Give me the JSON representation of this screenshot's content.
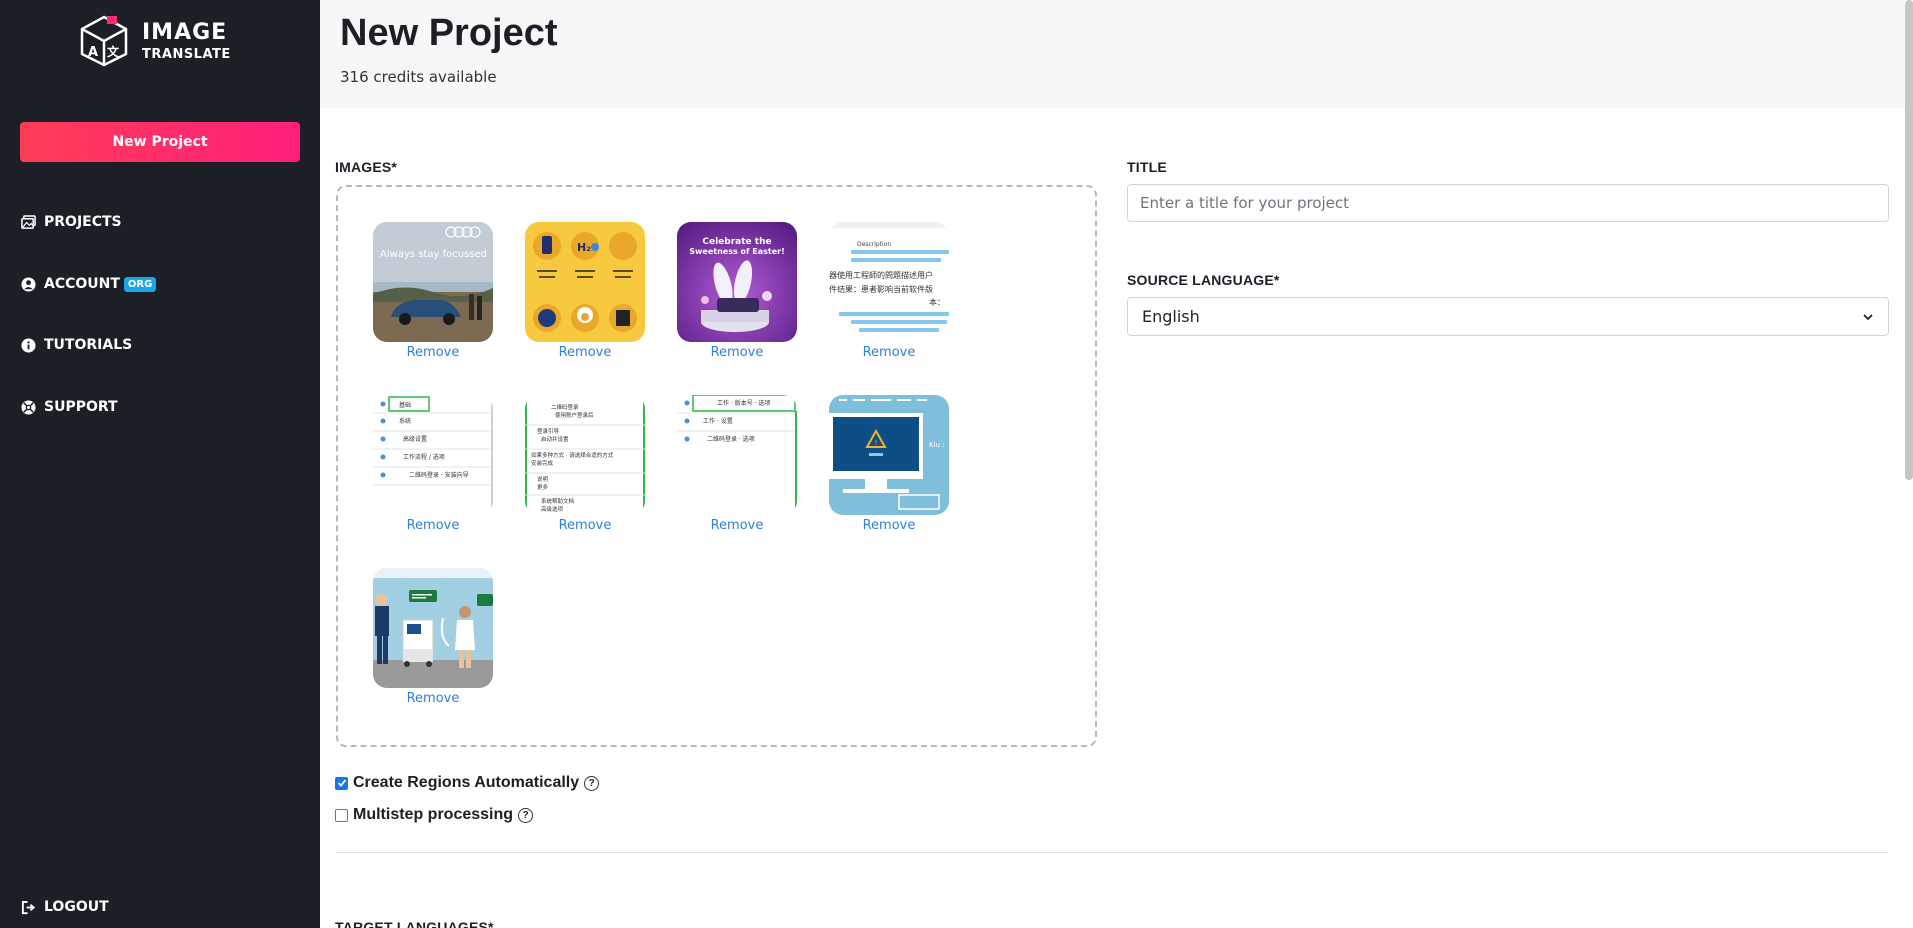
{
  "brand": {
    "line1": "IMAGE",
    "line2": "TRANSLATE"
  },
  "sidebar": {
    "new_project_label": "New Project",
    "items": [
      {
        "label": "PROJECTS",
        "icon": "images-icon"
      },
      {
        "label": "ACCOUNT",
        "icon": "user-circle-icon",
        "badge": "ORG"
      },
      {
        "label": "TUTORIALS",
        "icon": "info-circle-icon"
      },
      {
        "label": "SUPPORT",
        "icon": "lifebuoy-icon"
      }
    ],
    "logout_label": "LOGOUT"
  },
  "header": {
    "title": "New Project",
    "credits": "316 credits available"
  },
  "images": {
    "label": "IMAGES*",
    "remove_label": "Remove",
    "thumbs": [
      {
        "name": "car-ad",
        "caption": "Always stay focussed"
      },
      {
        "name": "yellow-grid-ad"
      },
      {
        "name": "easter-ad",
        "caption": "Celebrate the Sweetness of Easter!"
      },
      {
        "name": "chinese-document"
      },
      {
        "name": "chinese-list-1"
      },
      {
        "name": "chinese-list-2"
      },
      {
        "name": "chinese-list-3"
      },
      {
        "name": "computer-warning"
      },
      {
        "name": "hospital-scene"
      }
    ]
  },
  "title_field": {
    "label": "TITLE",
    "placeholder": "Enter a title for your project",
    "value": ""
  },
  "source_language": {
    "label": "SOURCE LANGUAGE*",
    "value": "English"
  },
  "options": {
    "create_regions": {
      "label": "Create Regions Automatically",
      "checked": true
    },
    "multistep": {
      "label": "Multistep processing",
      "checked": false
    }
  },
  "target_languages": {
    "label": "TARGET LANGUAGES*"
  },
  "colors": {
    "sidebar": "#1c1f26",
    "accent_gradient_start": "#ff3d57",
    "accent_gradient_end": "#ff1f7a",
    "link": "#2f7fd8",
    "badge": "#1aa7e8"
  }
}
